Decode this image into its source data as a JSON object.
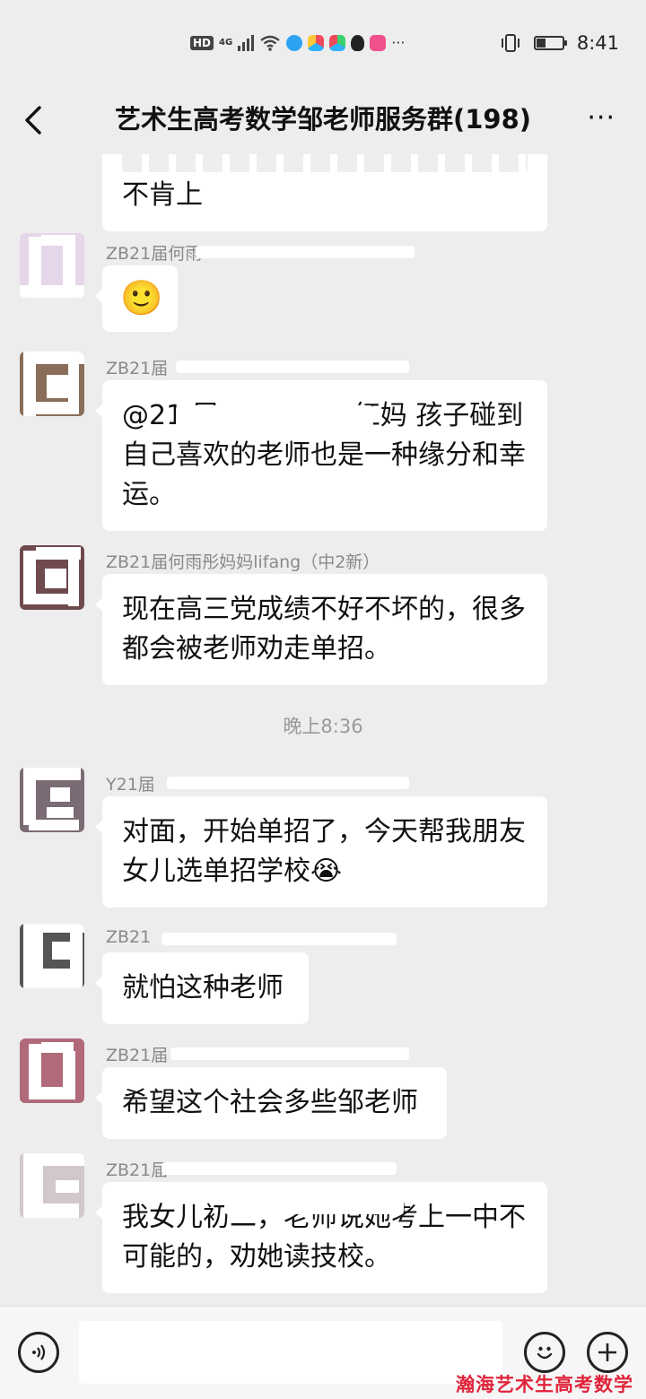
{
  "status_bar": {
    "hd": "HD",
    "network": "4G",
    "more": "···",
    "time": "8:41",
    "battery_level": 0.35
  },
  "header": {
    "title": "艺术生高考数学邹老师服务群(198)",
    "more": "···"
  },
  "messages": [
    {
      "sender": "",
      "text": "不肯上"
    },
    {
      "sender": "ZB21届何雨",
      "text": "🙂"
    },
    {
      "sender": "ZB21届",
      "text": "@21 届　　　　　红妈  孩子碰到自己喜欢的老师也是一种缘分和幸运。"
    },
    {
      "sender": "ZB21届何雨彤妈妈lifang（中2新）",
      "text": "现在高三党成绩不好不坏的，很多都会被老师劝走单招。"
    },
    {
      "sender": "Y21届",
      "text": "对面，开始单招了，今天帮我朋友女儿选单招学校😭"
    },
    {
      "sender": "ZB21",
      "text": "就怕这种老师"
    },
    {
      "sender": "ZB21届",
      "text": "希望这个社会多些邹老师"
    },
    {
      "sender": "ZB21届",
      "text": "我女儿初二，老师说她考上一中不可能的，劝她读技校。"
    }
  ],
  "timestamp": "晚上8:36",
  "input_bar": {
    "voice_icon": "voice-icon",
    "emoji_icon": "emoji-icon",
    "plus_icon": "plus-icon",
    "value": ""
  },
  "watermark": "瀚海艺术生高考数学"
}
